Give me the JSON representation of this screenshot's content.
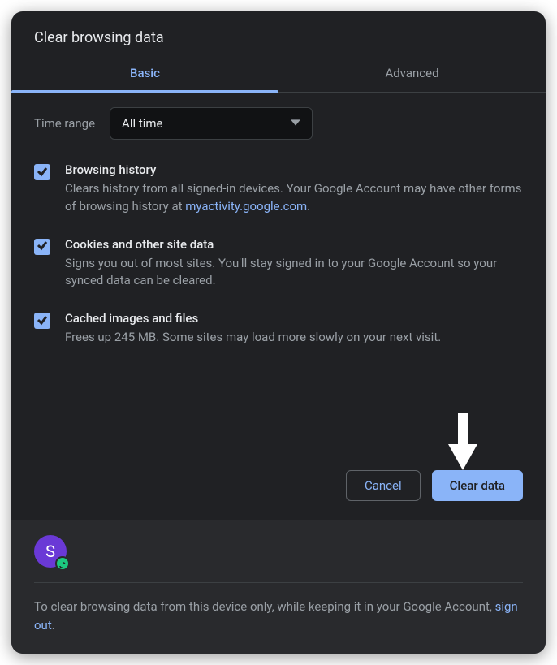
{
  "dialog": {
    "title": "Clear browsing data"
  },
  "tabs": {
    "basic": "Basic",
    "advanced": "Advanced"
  },
  "timeRange": {
    "label": "Time range",
    "value": "All time"
  },
  "options": {
    "history": {
      "title": "Browsing history",
      "desc1": "Clears history from all signed-in devices. Your Google Account may have other forms of browsing history at ",
      "link": "myactivity.google.com",
      "desc2": "."
    },
    "cookies": {
      "title": "Cookies and other site data",
      "desc": "Signs you out of most sites. You'll stay signed in to your Google Account so your synced data can be cleared."
    },
    "cache": {
      "title": "Cached images and files",
      "desc": "Frees up 245 MB. Some sites may load more slowly on your next visit."
    }
  },
  "buttons": {
    "cancel": "Cancel",
    "clear": "Clear data"
  },
  "footer": {
    "avatarLetter": "S",
    "text1": "To clear browsing data from this device only, while keeping it in your Google Account, ",
    "link": "sign out",
    "text2": "."
  }
}
